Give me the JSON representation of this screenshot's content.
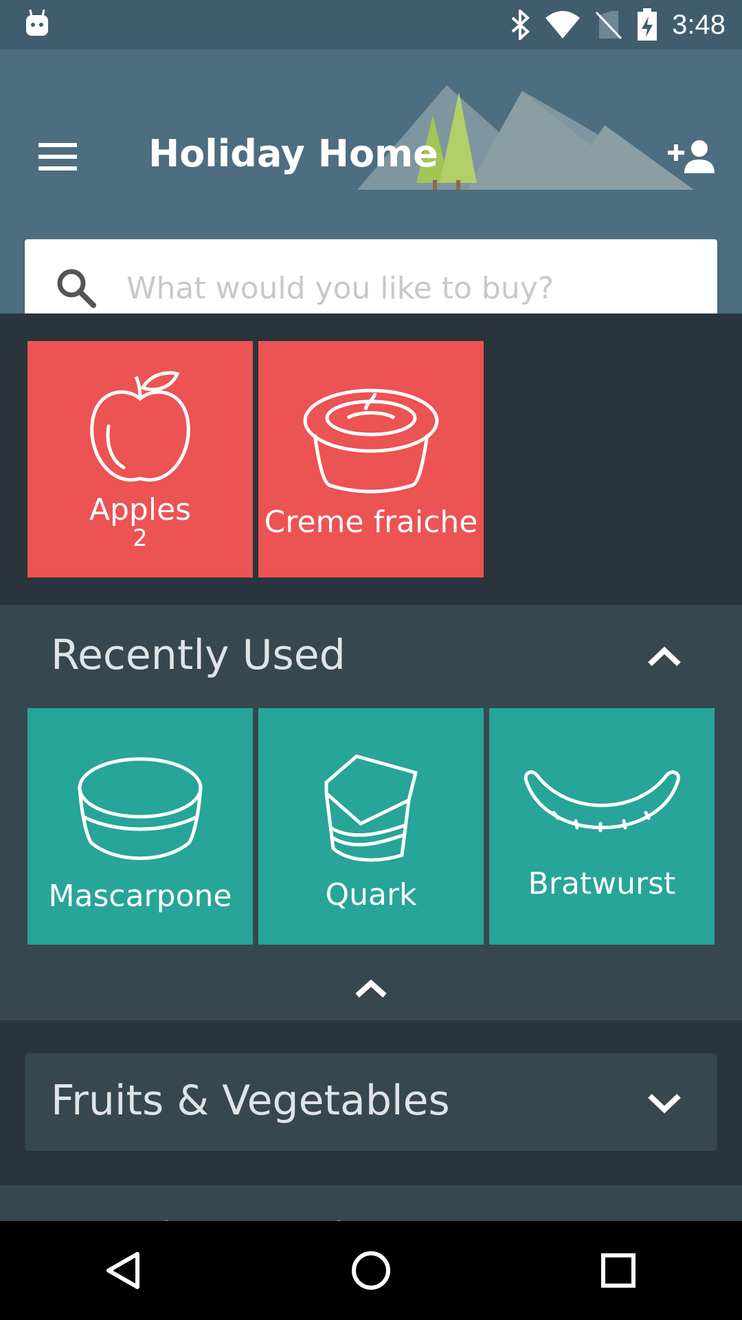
{
  "status_bar": {
    "time": "3:48",
    "icons": [
      "android-icon",
      "bluetooth-icon",
      "wifi-icon",
      "no-sim-icon",
      "battery-charging-icon"
    ]
  },
  "app_bar": {
    "title": "Holiday Home",
    "menu_icon": "menu-icon",
    "add_user_icon": "add-user-icon"
  },
  "search": {
    "placeholder": "What would you like to buy?",
    "value": ""
  },
  "shopping_list": {
    "items": [
      {
        "label": "Apples",
        "count": "2",
        "icon": "apple-icon"
      },
      {
        "label": "Creme fraiche",
        "count": "",
        "icon": "creme-fraiche-icon"
      }
    ]
  },
  "recently_used": {
    "title": "Recently Used",
    "items": [
      {
        "label": "Mascarpone",
        "icon": "mascarpone-icon"
      },
      {
        "label": "Quark",
        "icon": "quark-icon"
      },
      {
        "label": "Bratwurst",
        "icon": "bratwurst-icon"
      }
    ]
  },
  "categories": [
    {
      "title": "Fruits & Vegetables"
    },
    {
      "title": "Bread & Pastries"
    }
  ],
  "nav_bar": {
    "buttons": [
      "back-icon",
      "home-icon",
      "recents-icon"
    ]
  },
  "colors": {
    "list_tile": "#ec5353",
    "recent_tile": "#27a598",
    "app_bar": "#4d6d80",
    "background": "#2a343c",
    "section": "#37474f"
  }
}
